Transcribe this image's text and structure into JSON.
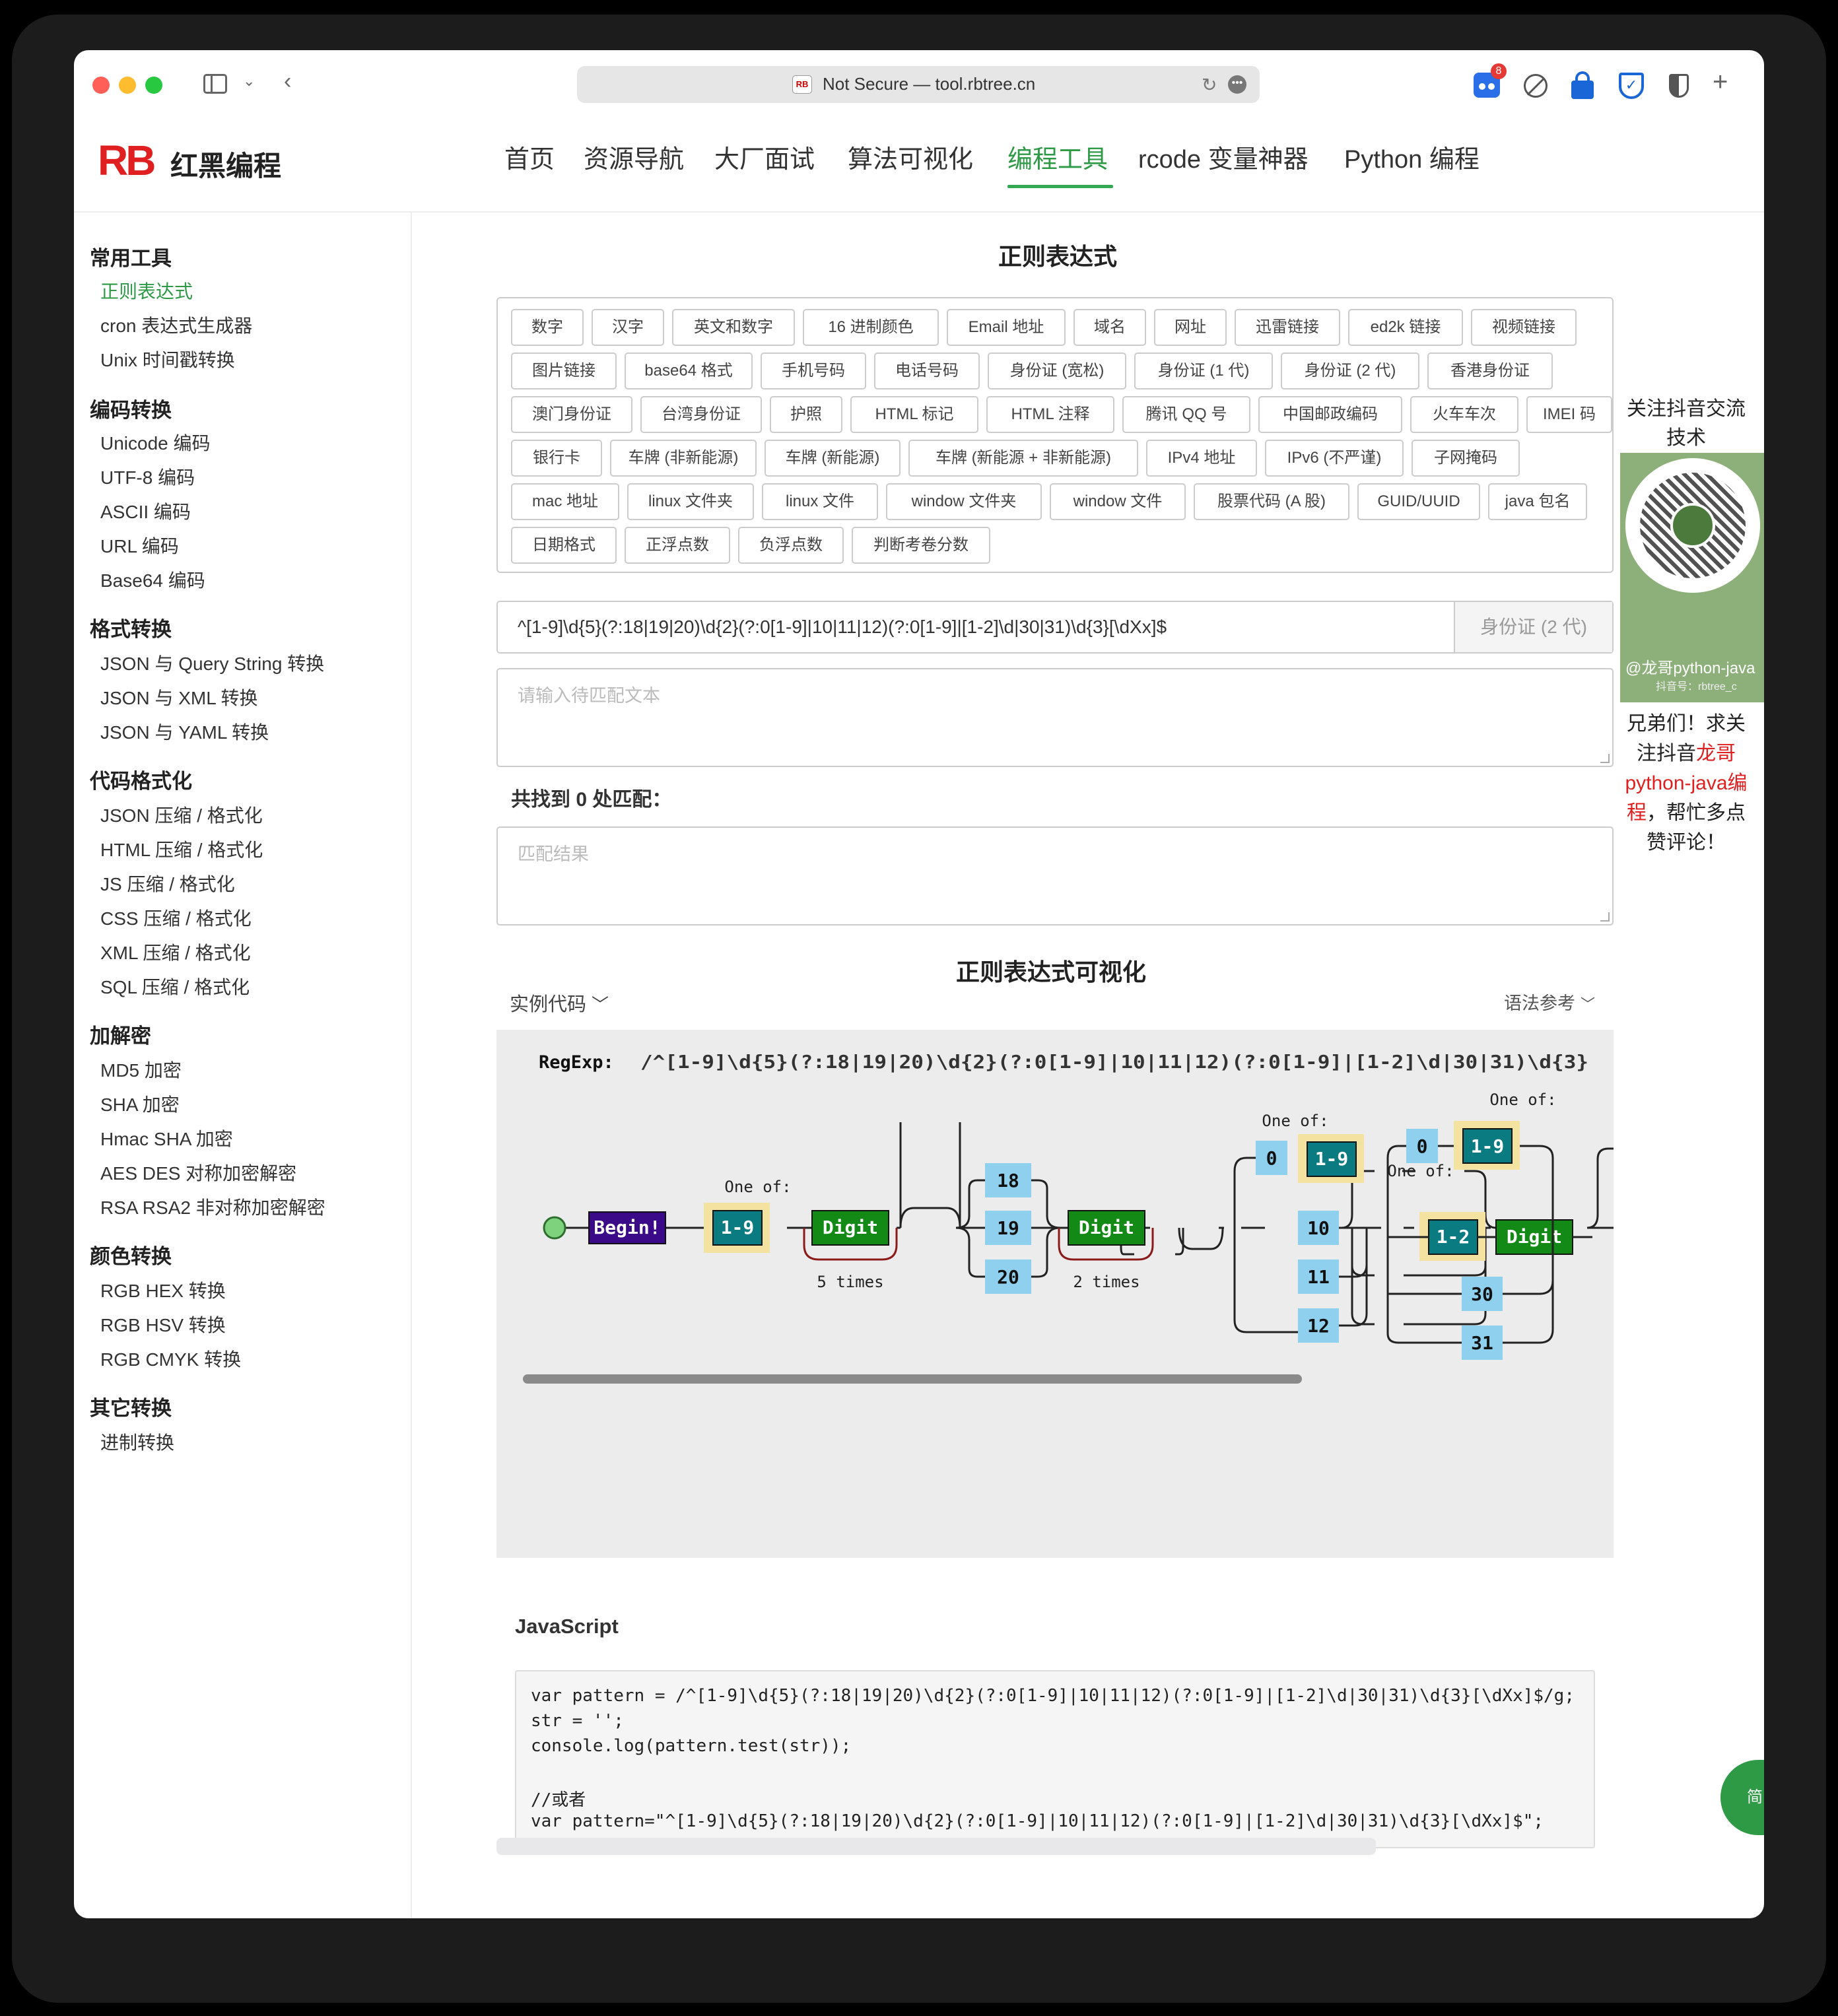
{
  "browser": {
    "address": "Not Secure — tool.rbtree.cn",
    "favicon_text": "RB",
    "extension_badge": "8"
  },
  "site": {
    "logo_mark": "RB",
    "logo_text": "红黑编程",
    "nav": [
      "首页",
      "资源导航",
      "大厂面试",
      "算法可视化",
      "编程工具",
      "rcode 变量神器",
      "Python 编程"
    ],
    "nav_active": "编程工具"
  },
  "sidebar": {
    "groups": [
      {
        "title": "常用工具",
        "items": [
          "正则表达式",
          "cron 表达式生成器",
          "Unix 时间戳转换"
        ]
      },
      {
        "title": "编码转换",
        "items": [
          "Unicode 编码",
          "UTF-8 编码",
          "ASCII 编码",
          "URL 编码",
          "Base64 编码"
        ]
      },
      {
        "title": "格式转换",
        "items": [
          "JSON 与 Query String 转换",
          "JSON 与 XML 转换",
          "JSON 与 YAML 转换"
        ]
      },
      {
        "title": "代码格式化",
        "items": [
          "JSON 压缩 / 格式化",
          "HTML 压缩 / 格式化",
          "JS 压缩 / 格式化",
          "CSS 压缩 / 格式化",
          "XML 压缩 / 格式化",
          "SQL 压缩 / 格式化"
        ]
      },
      {
        "title": "加解密",
        "items": [
          "MD5 加密",
          "SHA 加密",
          "Hmac SHA 加密",
          "AES DES 对称加密解密",
          "RSA RSA2 非对称加密解密"
        ]
      },
      {
        "title": "颜色转换",
        "items": [
          "RGB HEX 转换",
          "RGB HSV 转换",
          "RGB CMYK 转换"
        ]
      },
      {
        "title": "其它转换",
        "items": [
          "进制转换"
        ]
      }
    ],
    "active_item": "正则表达式"
  },
  "main": {
    "title": "正则表达式",
    "tag_rows": [
      [
        "数字",
        "汉字",
        "英文和数字",
        "16 进制颜色",
        "Email 地址",
        "域名",
        "网址",
        "迅雷链接",
        "ed2k 链接",
        "视频链接"
      ],
      [
        "图片链接",
        "base64 格式",
        "手机号码",
        "电话号码",
        "身份证 (宽松)",
        "身份证 (1 代)",
        "身份证 (2 代)",
        "香港身份证"
      ],
      [
        "澳门身份证",
        "台湾身份证",
        "护照",
        "HTML 标记",
        "HTML 注释",
        "腾讯 QQ 号",
        "中国邮政编码",
        "火车车次",
        "IMEI 码"
      ],
      [
        "银行卡",
        "车牌 (非新能源)",
        "车牌 (新能源)",
        "车牌 (新能源 + 非新能源)",
        "IPv4 地址",
        "IPv6 (不严谨)",
        "子网掩码"
      ],
      [
        "mac 地址",
        "linux 文件夹",
        "linux 文件",
        "window 文件夹",
        "window 文件",
        "股票代码 (A 股)",
        "GUID/UUID",
        "java 包名"
      ],
      [
        "日期格式",
        "正浮点数",
        "负浮点数",
        "判断考卷分数"
      ]
    ],
    "regex_value": "^[1-9]\\d{5}(?:18|19|20)\\d{2}(?:0[1-9]|10|11|12)(?:0[1-9]|[1-2]\\d|30|31)\\d{3}[\\dXx]$",
    "regex_side": "身份证 (2 代)",
    "input_placeholder": "请输入待匹配文本",
    "match_count_text": "共找到 0 处匹配：",
    "result_placeholder": "匹配结果",
    "viz_title": "正则表达式可视化",
    "example_code_label": "实例代码",
    "syntax_ref_label": "语法参考",
    "js_label": "JavaScript",
    "code_lines": [
      "var pattern = /^[1-9]\\d{5}(?:18|19|20)\\d{2}(?:0[1-9]|10|11|12)(?:0[1-9]|[1-2]\\d|30|31)\\d{3}[\\dXx]$/g;",
      "str = '';",
      "console.log(pattern.test(str));",
      "",
      "//或者",
      "var pattern=\"^[1-9]\\d{5}(?:18|19|20)\\d{2}(?:0[1-9]|10|11|12)(?:0[1-9]|[1-2]\\d|30|31)\\d{3}[\\dXx]$\";"
    ]
  },
  "diagram": {
    "regexp_label": "RegExp:",
    "regexp_text": "/^[1-9]\\d{5}(?:18|19|20)\\d{2}(?:0[1-9]|10|11|12)(?:0[1-9]|[1-2]\\d|30|31)\\d{3}",
    "begin": "Begin!",
    "one_of": "One of:",
    "range_1_9": "1-9",
    "range_1_2": "1-2",
    "digit": "Digit",
    "five_times": "5 times",
    "two_times": "2 times",
    "years": [
      "18",
      "19",
      "20"
    ],
    "months": [
      "0",
      "10",
      "11",
      "12"
    ],
    "days": [
      "0",
      "30",
      "31"
    ]
  },
  "promo": {
    "heading": "关注抖音交流技术",
    "qr_caption": "@龙哥python-java",
    "qr_sub": "抖音号：rbtree_c",
    "text_before": "兄弟们！求关注抖音",
    "text_highlight": "龙哥python-java编程",
    "text_after": "，帮忙多点赞评论！",
    "fab": "简 中"
  },
  "colors": {
    "accent_green": "#2e9a46",
    "brand_red": "#e02020",
    "diagram_begin": "#3b0a88",
    "diagram_range": "#0b7b82",
    "diagram_digit": "#138a16",
    "diagram_literal": "#8fd0ef",
    "diagram_highlight": "#f4e3a0"
  }
}
